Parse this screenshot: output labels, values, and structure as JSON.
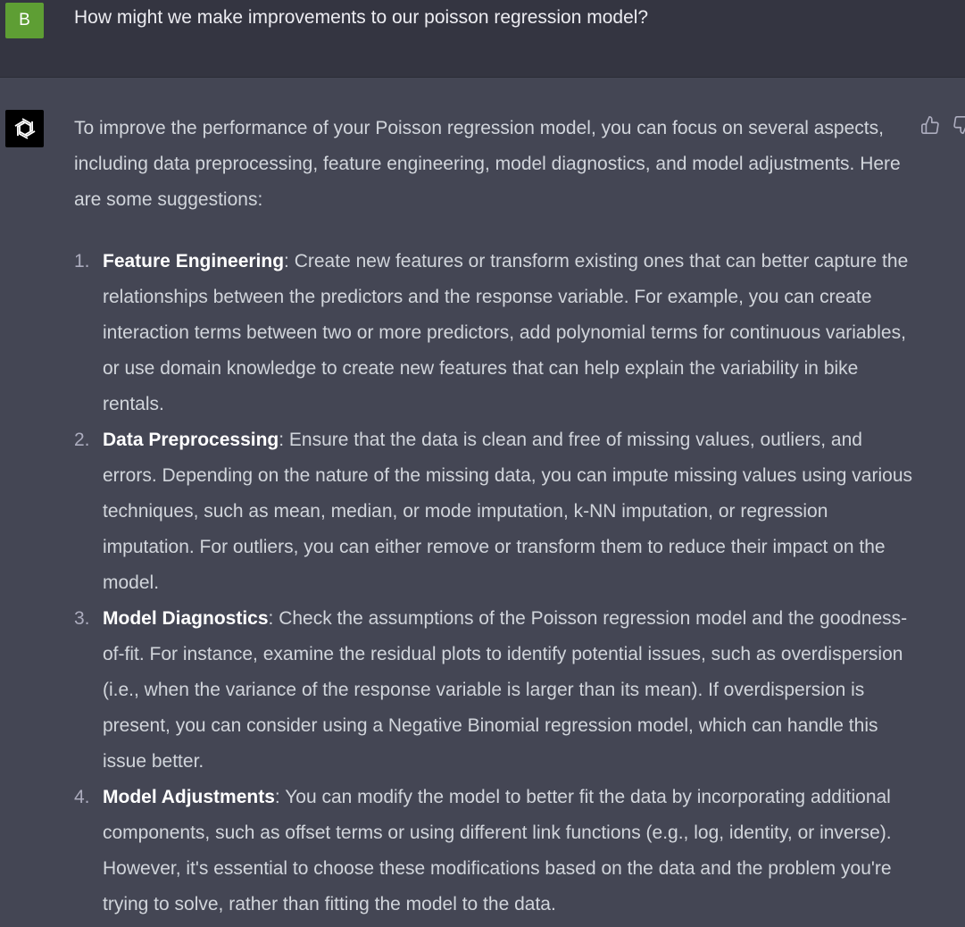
{
  "user_message": {
    "avatar_letter": "B",
    "text": "How might we make improvements to our poisson regression model?"
  },
  "assistant_message": {
    "intro": "To improve the performance of your Poisson regression model, you can focus on several aspects, including data preprocessing, feature engineering, model diagnostics, and model adjustments. Here are some suggestions:",
    "items": [
      {
        "number": "1.",
        "term": "Feature Engineering",
        "text": ": Create new features or transform existing ones that can better capture the relationships between the predictors and the response variable. For example, you can create interaction terms between two or more predictors, add polynomial terms for continuous variables, or use domain knowledge to create new features that can help explain the variability in bike rentals."
      },
      {
        "number": "2.",
        "term": "Data Preprocessing",
        "text": ": Ensure that the data is clean and free of missing values, outliers, and errors. Depending on the nature of the missing data, you can impute missing values using various techniques, such as mean, median, or mode imputation, k-NN imputation, or regression imputation. For outliers, you can either remove or transform them to reduce their impact on the model."
      },
      {
        "number": "3.",
        "term": "Model Diagnostics",
        "text": ": Check the assumptions of the Poisson regression model and the goodness-of-fit. For instance, examine the residual plots to identify potential issues, such as overdispersion (i.e., when the variance of the response variable is larger than its mean). If overdispersion is present, you can consider using a Negative Binomial regression model, which can handle this issue better."
      },
      {
        "number": "4.",
        "term": "Model Adjustments",
        "text": ": You can modify the model to better fit the data by incorporating additional components, such as offset terms or using different link functions (e.g., log, identity, or inverse). However, it's essential to choose these modifications based on the data and the problem you're trying to solve, rather than fitting the model to the data."
      }
    ]
  },
  "icons": {
    "bot_avatar": "openai-logo-icon",
    "thumbs_up": "thumbs-up-icon",
    "thumbs_down": "thumbs-down-icon"
  },
  "colors": {
    "user_bg": "#343541",
    "assistant_bg": "#444654",
    "user_avatar_bg": "#5e9e34",
    "bot_avatar_bg": "#000000"
  }
}
